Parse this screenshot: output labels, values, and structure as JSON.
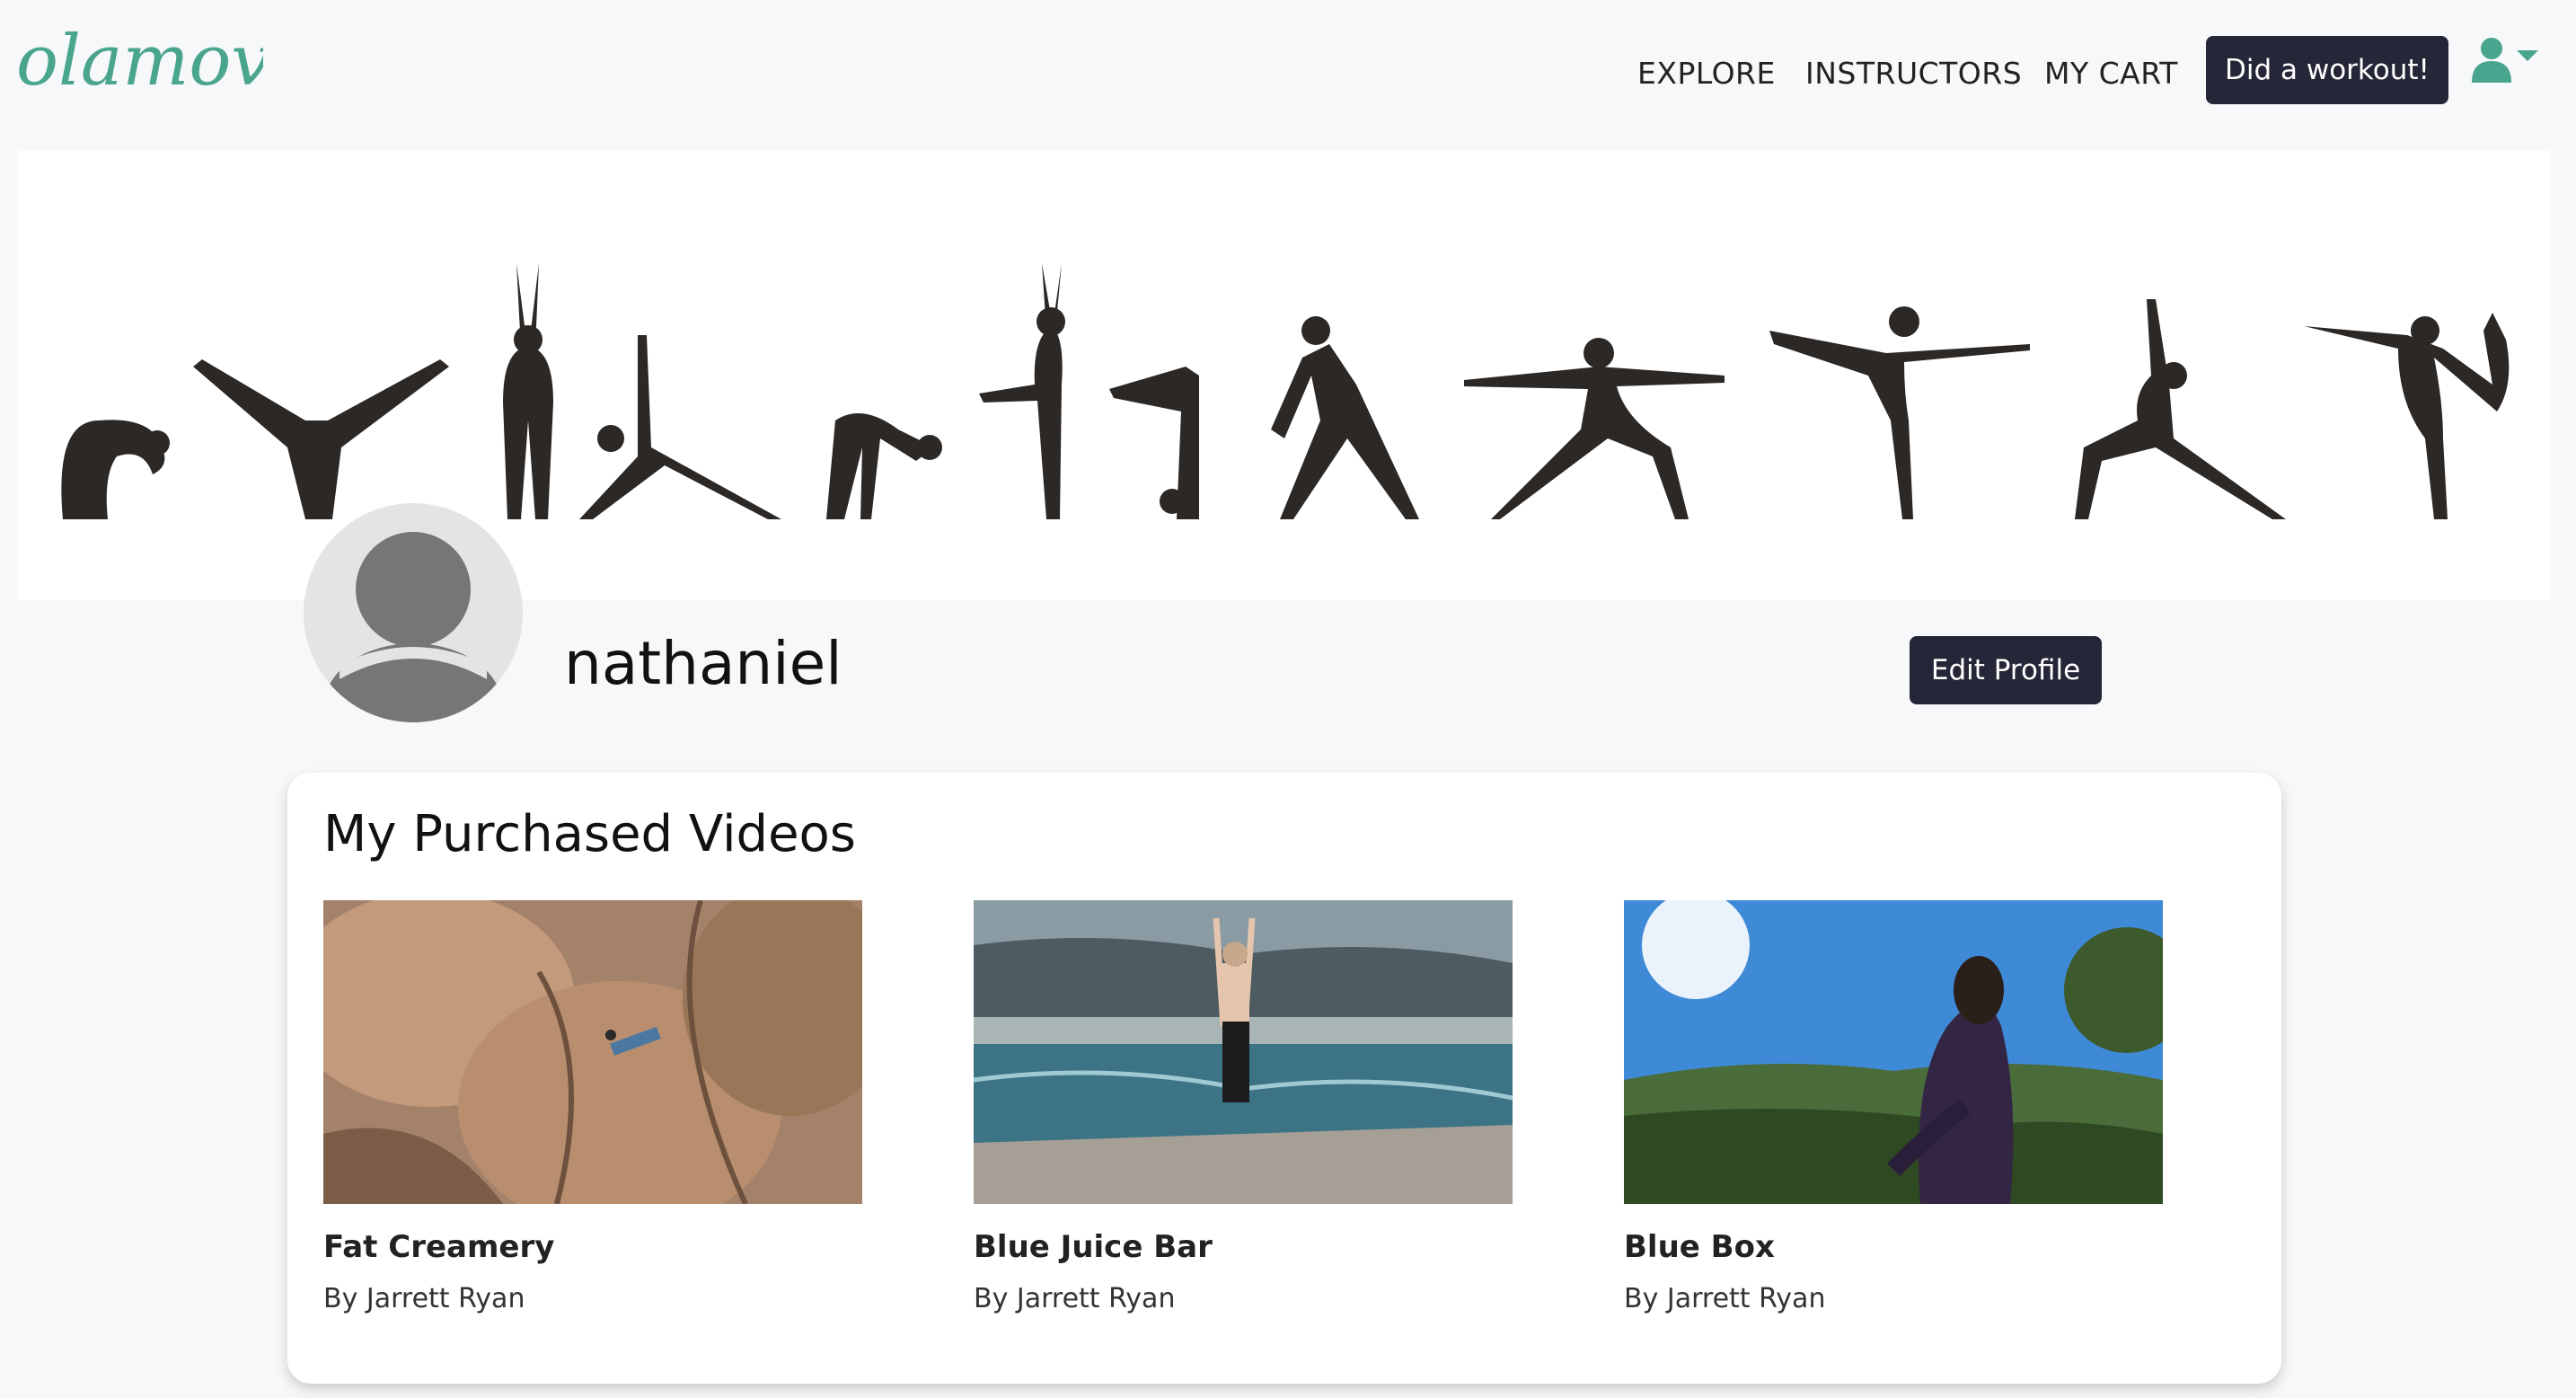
{
  "brand": {
    "logo_text": "olamoves",
    "color": "#4aa58e"
  },
  "nav": {
    "links": [
      "EXPLORE",
      "INSTRUCTORS",
      "MY CART"
    ],
    "cta_label": "Did a workout!",
    "user_icon": "user-icon"
  },
  "profile": {
    "username": "nathaniel",
    "edit_label": "Edit Profile"
  },
  "purchased": {
    "title": "My Purchased Videos",
    "videos": [
      {
        "title": "Fat Creamery",
        "by": "By Jarrett Ryan"
      },
      {
        "title": "Blue Juice Bar",
        "by": "By Jarrett Ryan"
      },
      {
        "title": "Blue Box",
        "by": "By Jarrett Ryan"
      }
    ]
  },
  "colors": {
    "dark_button": "#252637",
    "accent": "#4aa58e",
    "page_bg": "#f7f8fa"
  }
}
